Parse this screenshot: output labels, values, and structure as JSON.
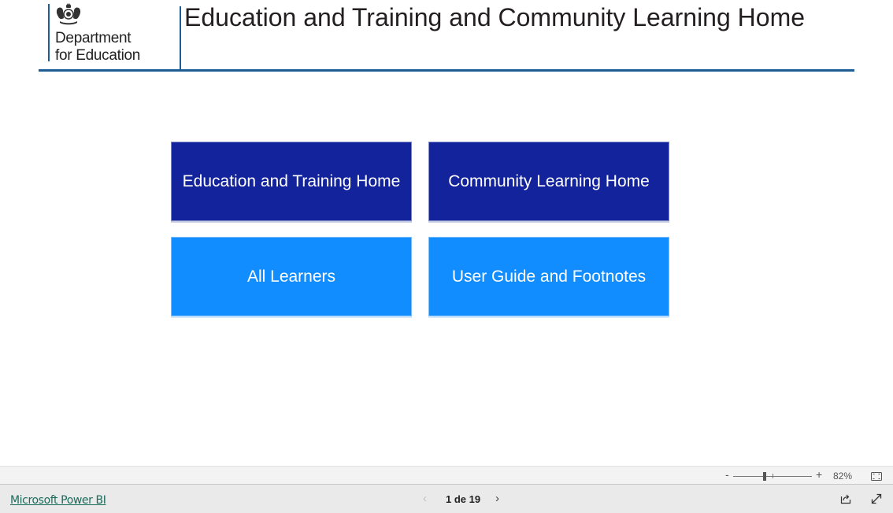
{
  "header": {
    "logo": {
      "icon": "royal-coat-of-arms-icon",
      "line1": "Department",
      "line2": "for Education"
    },
    "title": "Education and Training and Community Learning Home"
  },
  "navigation": {
    "buttons": [
      {
        "label": "Education and Training Home",
        "style": "dark",
        "color": "#13239b"
      },
      {
        "label": "Community Learning Home",
        "style": "dark",
        "color": "#13239b"
      },
      {
        "label": "All Learners",
        "style": "light",
        "color": "#118dff"
      },
      {
        "label": "User Guide and Footnotes",
        "style": "light",
        "color": "#118dff"
      }
    ]
  },
  "zoom_bar": {
    "minus_label": "-",
    "plus_label": "+",
    "zoom_value": "82%",
    "fit_icon": "fit-to-page-icon"
  },
  "footer": {
    "brand_link": "Microsoft Power BI",
    "prev_icon": "chevron-left-icon",
    "page_indicator": "1 de 19",
    "next_icon": "chevron-right-icon",
    "share_icon": "share-icon",
    "fullscreen_icon": "expand-icon"
  },
  "colors": {
    "accent_rule": "#1d5d96",
    "dark_button": "#13239b",
    "light_button": "#118dff",
    "link": "#1b6b5b"
  }
}
